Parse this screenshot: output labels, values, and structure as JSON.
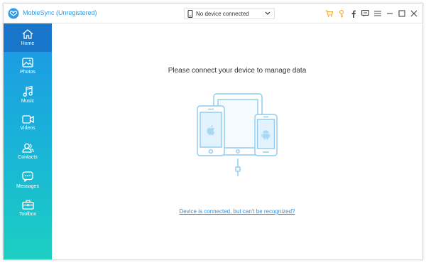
{
  "app": {
    "title": "MobieSync (Unregistered)"
  },
  "device_selector": {
    "value": "No device connected"
  },
  "toolbar_icons": [
    "cart-icon",
    "key-icon",
    "facebook-icon",
    "feedback-icon",
    "menu-icon",
    "minimize-icon",
    "maximize-icon",
    "close-icon"
  ],
  "sidebar": {
    "items": [
      {
        "label": "Home",
        "icon": "home-icon",
        "active": true
      },
      {
        "label": "Photos",
        "icon": "photos-icon",
        "active": false
      },
      {
        "label": "Music",
        "icon": "music-icon",
        "active": false
      },
      {
        "label": "Videos",
        "icon": "videos-icon",
        "active": false
      },
      {
        "label": "Contacts",
        "icon": "contacts-icon",
        "active": false
      },
      {
        "label": "Messages",
        "icon": "messages-icon",
        "active": false
      },
      {
        "label": "Toolbox",
        "icon": "toolbox-icon",
        "active": false
      }
    ]
  },
  "main": {
    "prompt": "Please connect your device to manage data",
    "help_link": "Device is connected, but can't be recognized?"
  },
  "colors": {
    "brand": "#2f9be6",
    "accent_orange": "#f5a623",
    "sidebar_top": "#1e96e6",
    "sidebar_bottom": "#1ccfc2",
    "active_item": "#1776c9",
    "illustration": "#8fcaf0"
  }
}
